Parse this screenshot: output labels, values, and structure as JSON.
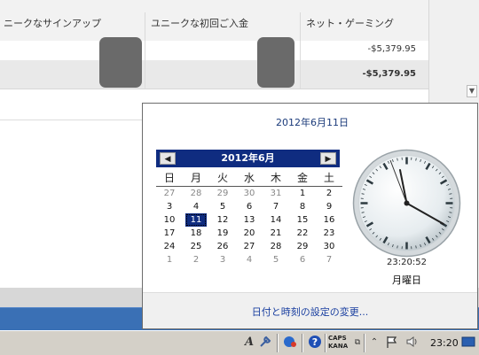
{
  "report": {
    "columns": [
      "ニークなサインアップ",
      "ユニークな初回ご入金",
      "ネット・ゲーミング"
    ],
    "row1_amount": "-$5,379.95",
    "row2_amount": "-$5,379.95"
  },
  "calendar_popup": {
    "long_date": "2012年6月11日",
    "month_title": "2012年6月",
    "prev_icon": "left-triangle",
    "next_icon": "right-triangle",
    "weekdays": [
      "日",
      "月",
      "火",
      "水",
      "木",
      "金",
      "土"
    ],
    "weeks": [
      [
        "27",
        "28",
        "29",
        "30",
        "31",
        "1",
        "2"
      ],
      [
        "3",
        "4",
        "5",
        "6",
        "7",
        "8",
        "9"
      ],
      [
        "10",
        "11",
        "12",
        "13",
        "14",
        "15",
        "16"
      ],
      [
        "17",
        "18",
        "19",
        "20",
        "21",
        "22",
        "23"
      ],
      [
        "24",
        "25",
        "26",
        "27",
        "28",
        "29",
        "30"
      ],
      [
        "1",
        "2",
        "3",
        "4",
        "5",
        "6",
        "7"
      ]
    ],
    "selected_day": "11",
    "analog_time": "23:20:52",
    "weekday_label": "月曜日",
    "settings_link": "日付と時刻の設定の変更..."
  },
  "taskbar": {
    "caps_label": "CAPS",
    "kana_label": "KANA",
    "clock": "23:20",
    "icons": [
      "ime-icon",
      "tools-icon",
      "app-icon",
      "help-icon",
      "ime-mode-icon",
      "show-hidden-icon",
      "flag-icon",
      "volume-icon",
      "desktop-icon"
    ]
  },
  "colors": {
    "calendar_header": "#0f2c80",
    "taskbar_blue": "#3a70b5",
    "link": "#1a3fa0"
  }
}
